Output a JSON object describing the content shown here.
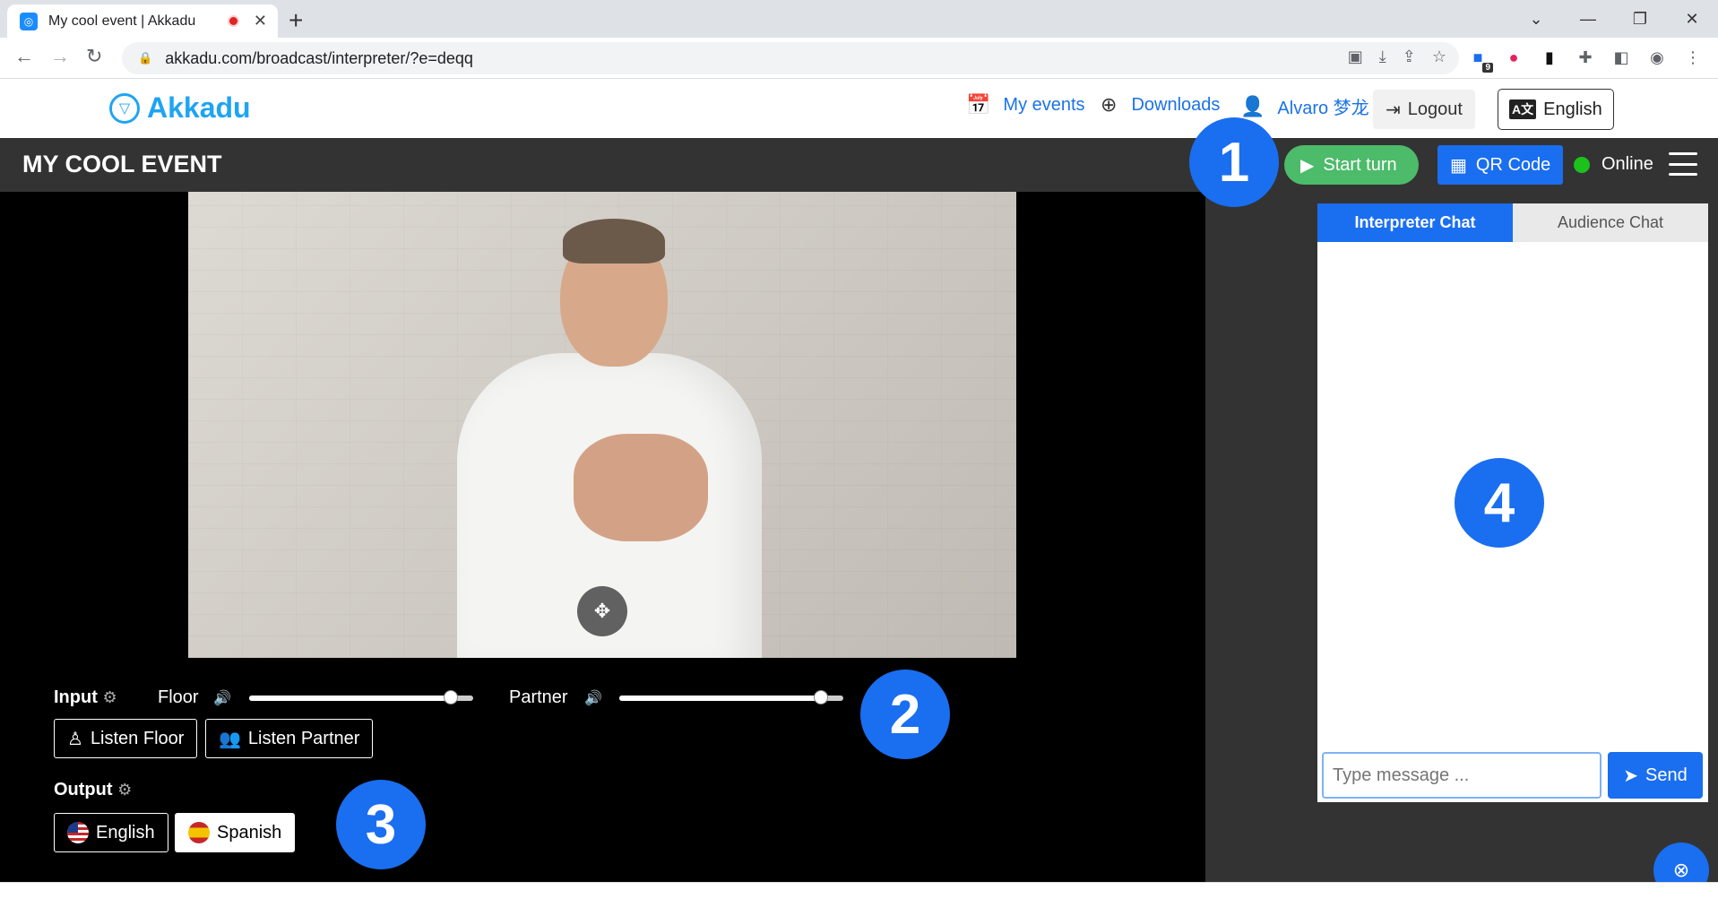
{
  "browser": {
    "tab_title": "My cool event | Akkadu",
    "url": "akkadu.com/broadcast/interpreter/?e=deqq",
    "extension_badge": "9"
  },
  "header": {
    "logo_text": "Akkadu",
    "my_events": "My events",
    "downloads": "Downloads",
    "user_name": "Alvaro 梦龙",
    "logout": "Logout",
    "language": "English"
  },
  "event_bar": {
    "title": "MY COOL EVENT",
    "start_turn": "Start turn",
    "qr_code": "QR Code",
    "status": "Online"
  },
  "controls": {
    "input_label": "Input",
    "floor_label": "Floor",
    "floor_volume": 0.9,
    "partner_label": "Partner",
    "partner_volume": 0.9,
    "listen_floor": "Listen Floor",
    "listen_partner": "Listen Partner",
    "output_label": "Output",
    "output_languages": [
      "English",
      "Spanish"
    ],
    "selected_output": "Spanish"
  },
  "badges": [
    "1",
    "2",
    "3",
    "4"
  ],
  "chat": {
    "tabs": [
      "Interpreter Chat",
      "Audience Chat"
    ],
    "active_tab": "Interpreter Chat",
    "placeholder": "Type message ...",
    "send": "Send"
  },
  "colors": {
    "brand_blue": "#1a6ef0",
    "start_green": "#4cbb6a",
    "online_green": "#1cc11c",
    "logo_blue": "#1fa4f3"
  }
}
